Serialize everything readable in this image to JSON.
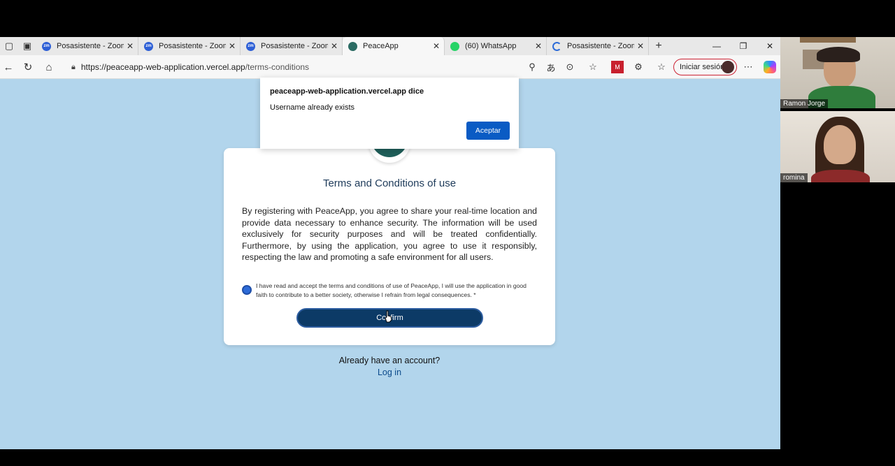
{
  "browser": {
    "tabs": [
      {
        "label": "Posasistente - Zoom",
        "favicon": "zoom-icon"
      },
      {
        "label": "Posasistente - Zoom",
        "favicon": "zoom-icon"
      },
      {
        "label": "Posasistente - Zoom",
        "favicon": "zoom-icon"
      },
      {
        "label": "PeaceApp",
        "favicon": "peaceapp-icon",
        "active": true
      },
      {
        "label": "(60) WhatsApp",
        "favicon": "whatsapp-icon"
      },
      {
        "label": "Posasistente - Zoom",
        "favicon": "loading-icon"
      }
    ],
    "url_host": "https://peaceapp-web-application.vercel.app",
    "url_path": "/terms-conditions",
    "signin_label": "Iniciar sesión"
  },
  "alert": {
    "title": "peaceapp-web-application.vercel.app dice",
    "message": "Username already exists",
    "button": "Aceptar"
  },
  "page": {
    "title": "Terms and Conditions of use",
    "body": "By registering with PeaceApp, you agree to share your real-time location and provide data necessary to enhance security. The information will be used exclusively for security purposes and will be treated confidentially. Furthermore, by using the application, you agree to use it responsibly, respecting the law and promoting a safe environment for all users.",
    "accept_text": "I have read and accept the terms and conditions of use of PeaceApp, I will use the application in good faith to contribute to a better society, otherwise I refrain from legal consequences. *",
    "confirm_label": "Confirm",
    "have_account": "Already have an account?",
    "login_link": "Log in"
  },
  "zoom": {
    "participants": [
      {
        "name": "Ramon Jorge"
      },
      {
        "name": "romina"
      }
    ]
  },
  "colors": {
    "page_bg": "#b2d5ec",
    "primary_button": "#0c3a66",
    "alert_button": "#0a5bc4",
    "link": "#0b4a8b"
  }
}
